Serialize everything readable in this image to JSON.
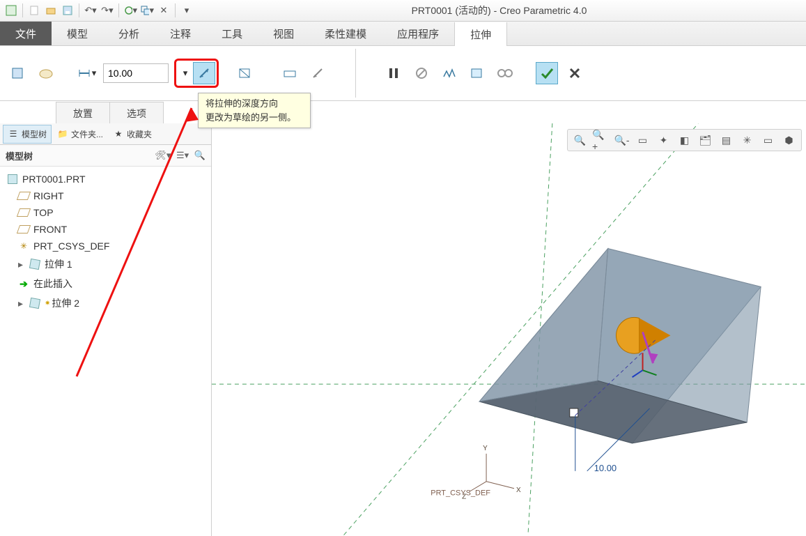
{
  "app": {
    "title": "PRT0001 (活动的) - Creo Parametric 4.0"
  },
  "ribbon": {
    "tabs": {
      "file": "文件",
      "model": "模型",
      "analyze": "分析",
      "annotate": "注释",
      "tools": "工具",
      "view": "视图",
      "flex": "柔性建模",
      "apps": "应用程序",
      "extrude": "拉伸"
    },
    "depth_value": "10.00"
  },
  "subtabs": {
    "place": "放置",
    "options": "选项"
  },
  "tooltip": {
    "line1": "将拉伸的深度方向",
    "line2": "更改为草绘的另一侧。"
  },
  "panel": {
    "tabs": {
      "tree": "模型树",
      "folders": "文件夹...",
      "fav": "收藏夹"
    },
    "header": "模型树"
  },
  "tree": {
    "part": "PRT0001.PRT",
    "right": "RIGHT",
    "top": "TOP",
    "front": "FRONT",
    "csys": "PRT_CSYS_DEF",
    "ext1": "拉伸 1",
    "insert": "在此插入",
    "ext2": "拉伸 2"
  },
  "viewport": {
    "dim": "10.00",
    "csys": "PRT_CSYS_DEF",
    "ax_x": "X",
    "ax_y": "Y",
    "ax_z": "Z"
  }
}
